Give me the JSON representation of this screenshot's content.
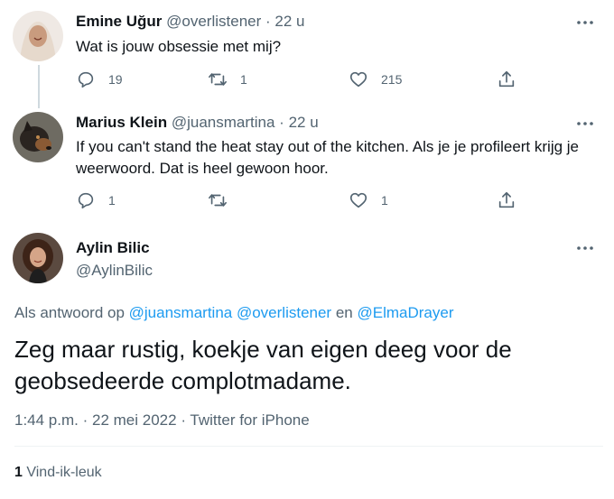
{
  "tweets": [
    {
      "name": "Emine Uğur",
      "handle": "@overlistener",
      "separator": "·",
      "time": "22 u",
      "text": "Wat is jouw obsessie met mij?",
      "replies": "19",
      "retweets": "1",
      "likes": "215"
    },
    {
      "name": "Marius Klein",
      "handle": "@juansmartina",
      "separator": "·",
      "time": "22 u",
      "text_line1": "If you can't stand the heat stay out of the kitchen. Als je je profileert krijg je",
      "text_line2": "weerwoord. Dat is heel gewoon hoor.",
      "replies": "1",
      "retweets": "",
      "likes": "1"
    }
  ],
  "main_tweet": {
    "name": "Aylin Bilic",
    "handle": "@AylinBilic",
    "reply_prefix": "Als antwoord op",
    "mention1": "@juansmartina",
    "mention2": "@overlistener",
    "mention_conj": "en",
    "mention3": "@ElmaDrayer",
    "text": "Zeg maar rustig, koekje van eigen deeg voor de geobsedeerde complotmadame.",
    "time": "1:44 p.m.",
    "sep1": "·",
    "date": "22 mei 2022",
    "sep2": "·",
    "source": "Twitter for iPhone",
    "like_count": "1",
    "like_label": "Vind-ik-leuk"
  },
  "icons": {
    "reply": "reply-icon",
    "retweet": "retweet-icon",
    "like": "heart-icon",
    "share": "share-icon",
    "more": "more-icon"
  },
  "colors": {
    "link": "#1d9bf0",
    "secondary_text": "#536471",
    "primary_text": "#0f1419",
    "thread_line": "#cfd9de"
  }
}
